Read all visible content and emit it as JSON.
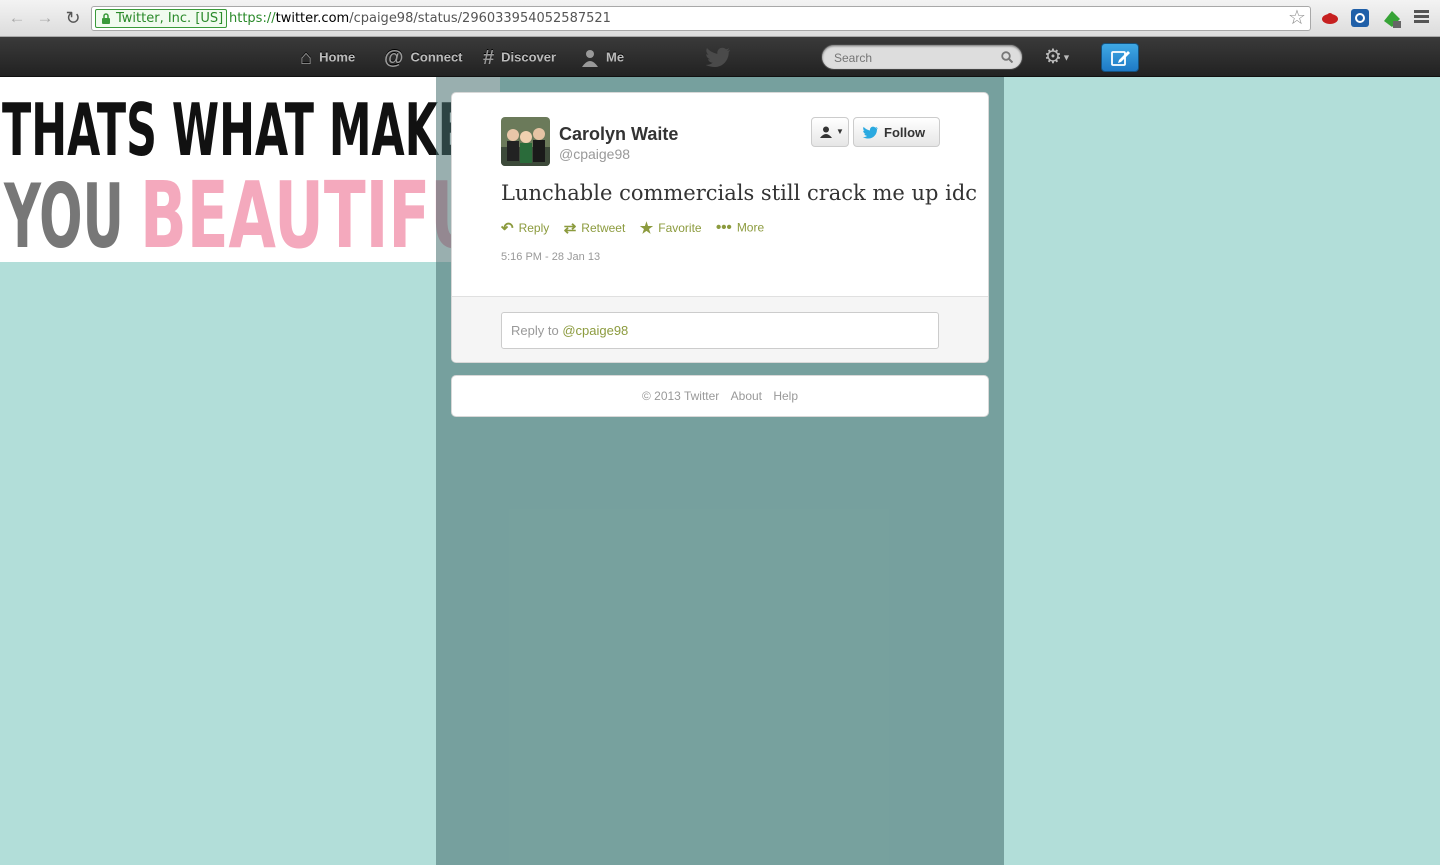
{
  "browser": {
    "ev_label": "Twitter, Inc. [US]",
    "url_scheme": "https://",
    "url_host": "twitter.com",
    "url_path": "/cpaige98/status/296033954052587521",
    "icons": [
      "back-arrow-icon",
      "forward-arrow-icon",
      "reload-icon",
      "lock-icon",
      "star-icon",
      "menu-icon"
    ]
  },
  "topbar": {
    "nav": [
      {
        "label": "Home",
        "icon": "home-icon"
      },
      {
        "label": "Connect",
        "icon": "at-icon"
      },
      {
        "label": "Discover",
        "icon": "hash-icon"
      },
      {
        "label": "Me",
        "icon": "person-icon"
      }
    ],
    "search_placeholder": "Search",
    "brand_color": "#1e79c5"
  },
  "header_image": {
    "line1": "THATS WHAT MAKES",
    "line2_a": "YOU",
    "line2_b": "BEAUTIFU"
  },
  "tweet": {
    "fullname": "Carolyn Waite",
    "username": "@cpaige98",
    "follow_label": "Follow",
    "text": "Lunchable commercials still crack me up idc",
    "actions": [
      {
        "label": "Reply",
        "icon": "reply-icon"
      },
      {
        "label": "Retweet",
        "icon": "retweet-icon"
      },
      {
        "label": "Favorite",
        "icon": "star-icon"
      },
      {
        "label": "More",
        "icon": "more-dots-icon"
      }
    ],
    "timestamp": "5:16 PM - 28 Jan 13",
    "reply_prefix": "Reply to ",
    "reply_mention": "@cpaige98",
    "link_color": "#8c9b3e"
  },
  "footer": {
    "copyright": "© 2013 Twitter",
    "about": "About",
    "help": "Help"
  },
  "colors": {
    "page_bg": "#b2ded9",
    "topbar": "#222222"
  }
}
